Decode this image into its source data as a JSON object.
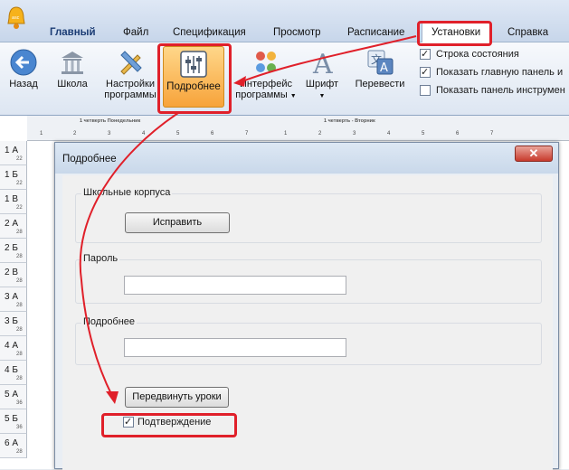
{
  "app": {
    "icon_name": "app-bell-icon"
  },
  "menu": {
    "tabs": [
      {
        "label": "Главный"
      },
      {
        "label": "Файл"
      },
      {
        "label": "Спецификация"
      },
      {
        "label": "Просмотр"
      },
      {
        "label": "Расписание"
      },
      {
        "label": "Установки"
      },
      {
        "label": "Справка"
      }
    ],
    "active_tab": "Установки"
  },
  "ribbon": {
    "buttons": [
      {
        "label": "Назад",
        "icon": "back-arrow-icon"
      },
      {
        "label": "Школа",
        "icon": "school-building-icon"
      },
      {
        "label": "Настройки программы",
        "label_line1": "Настройки",
        "label_line2": "программы",
        "icon": "pencil-ruler-icon"
      },
      {
        "label": "Подробнее",
        "icon": "sliders-icon",
        "selected": true
      },
      {
        "label": "Интерфейс программы",
        "label_line1": "Интерфейс",
        "label_line2": "программы",
        "icon": "palette-icon"
      },
      {
        "label": "Шрифт",
        "icon": "font-icon"
      },
      {
        "label": "Перевести",
        "icon": "translate-icon"
      }
    ],
    "checkboxes": [
      {
        "label": "Строка состояния",
        "checked": true
      },
      {
        "label": "Показать главную панель и",
        "checked": true
      },
      {
        "label": "Показать панель инструмен",
        "checked": false
      }
    ]
  },
  "schedule": {
    "days": [
      "1 четверть Понедельник",
      "1 четверть - Вторник"
    ],
    "periods": [
      "1",
      "2",
      "3",
      "4",
      "5",
      "6",
      "7"
    ],
    "classes": [
      {
        "name": "1 А",
        "count": "22"
      },
      {
        "name": "1 Б",
        "count": "22"
      },
      {
        "name": "1 В",
        "count": "22"
      },
      {
        "name": "2 А",
        "count": "28"
      },
      {
        "name": "2 Б",
        "count": "28"
      },
      {
        "name": "2 В",
        "count": "28"
      },
      {
        "name": "3 А",
        "count": "28"
      },
      {
        "name": "3 Б",
        "count": "28"
      },
      {
        "name": "4 А",
        "count": "28"
      },
      {
        "name": "4 Б",
        "count": "28"
      },
      {
        "name": "5 А",
        "count": "36"
      },
      {
        "name": "5 Б",
        "count": "36"
      },
      {
        "name": "6 А",
        "count": "28"
      }
    ]
  },
  "dialog": {
    "title": "Подробнее",
    "close_label": "✕",
    "buildings_group": "Школьные корпуса",
    "fix_button": "Исправить",
    "password_group": "Пароль",
    "password_value": "",
    "details_group": "Подробнее",
    "details_value": "",
    "move_lessons_button": "Передвинуть уроки",
    "confirm_checkbox": {
      "label": "Подтверждение",
      "checked": true
    }
  },
  "colors": {
    "annotation_red": "#e0202a",
    "selected_button": "#f7a33a",
    "close_button": "#c83a2c"
  }
}
